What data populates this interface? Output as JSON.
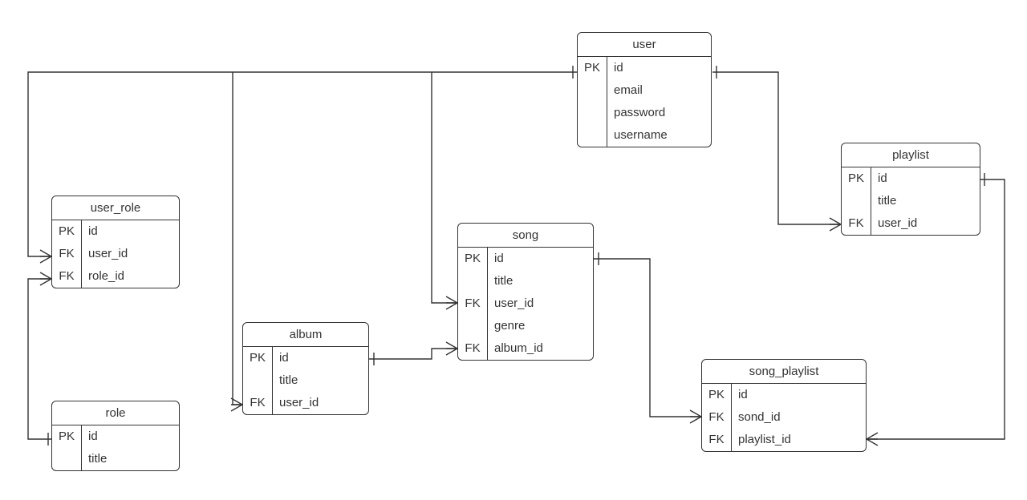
{
  "entities": {
    "user": {
      "title": "user",
      "fields": [
        {
          "key": "PK",
          "name": "id"
        },
        {
          "key": "",
          "name": "email"
        },
        {
          "key": "",
          "name": "password"
        },
        {
          "key": "",
          "name": "username"
        }
      ]
    },
    "user_role": {
      "title": "user_role",
      "fields": [
        {
          "key": "PK",
          "name": "id"
        },
        {
          "key": "FK",
          "name": "user_id"
        },
        {
          "key": "FK",
          "name": "role_id"
        }
      ]
    },
    "album": {
      "title": "album",
      "fields": [
        {
          "key": "PK",
          "name": "id"
        },
        {
          "key": "",
          "name": "title"
        },
        {
          "key": "FK",
          "name": "user_id"
        }
      ]
    },
    "role": {
      "title": "role",
      "fields": [
        {
          "key": "PK",
          "name": "id"
        },
        {
          "key": "",
          "name": "title"
        }
      ]
    },
    "song": {
      "title": "song",
      "fields": [
        {
          "key": "PK",
          "name": "id"
        },
        {
          "key": "",
          "name": "title"
        },
        {
          "key": "FK",
          "name": "user_id"
        },
        {
          "key": "",
          "name": "genre"
        },
        {
          "key": "FK",
          "name": "album_id"
        }
      ]
    },
    "playlist": {
      "title": "playlist",
      "fields": [
        {
          "key": "PK",
          "name": "id"
        },
        {
          "key": "",
          "name": "title"
        },
        {
          "key": "FK",
          "name": "user_id"
        }
      ]
    },
    "song_playlist": {
      "title": "song_playlist",
      "fields": [
        {
          "key": "PK",
          "name": "id"
        },
        {
          "key": "FK",
          "name": "sond_id"
        },
        {
          "key": "FK",
          "name": "playlist_id"
        }
      ]
    }
  },
  "relationships": [
    {
      "from": "user.id",
      "to": "user_role.user_id",
      "type": "one-to-many"
    },
    {
      "from": "role.id",
      "to": "user_role.role_id",
      "type": "one-to-many"
    },
    {
      "from": "user.id",
      "to": "album.user_id",
      "type": "one-to-many"
    },
    {
      "from": "user.id",
      "to": "song.user_id",
      "type": "one-to-many"
    },
    {
      "from": "album.id",
      "to": "song.album_id",
      "type": "one-to-many"
    },
    {
      "from": "user.id",
      "to": "playlist.user_id",
      "type": "one-to-many"
    },
    {
      "from": "song.id",
      "to": "song_playlist.sond_id",
      "type": "one-to-many"
    },
    {
      "from": "playlist.id",
      "to": "song_playlist.playlist_id",
      "type": "one-to-many"
    }
  ]
}
